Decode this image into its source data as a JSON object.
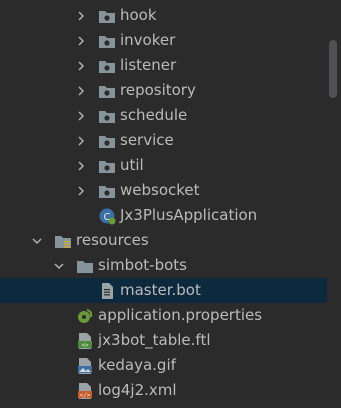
{
  "tree": {
    "packages": [
      {
        "label": "hook",
        "icon": "package-folder-icon"
      },
      {
        "label": "invoker",
        "icon": "package-folder-icon"
      },
      {
        "label": "listener",
        "icon": "package-folder-icon"
      },
      {
        "label": "repository",
        "icon": "package-folder-icon"
      },
      {
        "label": "schedule",
        "icon": "package-folder-icon"
      },
      {
        "label": "service",
        "icon": "package-folder-icon"
      },
      {
        "label": "util",
        "icon": "package-folder-icon"
      },
      {
        "label": "websocket",
        "icon": "package-folder-icon"
      }
    ],
    "app_class": {
      "label": "Jx3PlusApplication",
      "icon": "spring-boot-app-icon"
    },
    "resources": {
      "label": "resources",
      "icon": "resources-folder-icon"
    },
    "simbot_bots": {
      "label": "simbot-bots",
      "icon": "folder-icon"
    },
    "master_bot": {
      "label": "master.bot",
      "icon": "text-file-icon",
      "selected": true
    },
    "files": [
      {
        "label": "application.properties",
        "icon": "spring-properties-icon"
      },
      {
        "label": "jx3bot_table.ftl",
        "icon": "template-file-icon"
      },
      {
        "label": "kedaya.gif",
        "icon": "image-file-icon"
      },
      {
        "label": "log4j2.xml",
        "icon": "xml-file-icon"
      }
    ]
  },
  "colors": {
    "background": "#2b2b2b",
    "text": "#bbbbbb",
    "selection": "#0d293e",
    "folder": "#87939a",
    "spring": "#6a9a3b"
  }
}
